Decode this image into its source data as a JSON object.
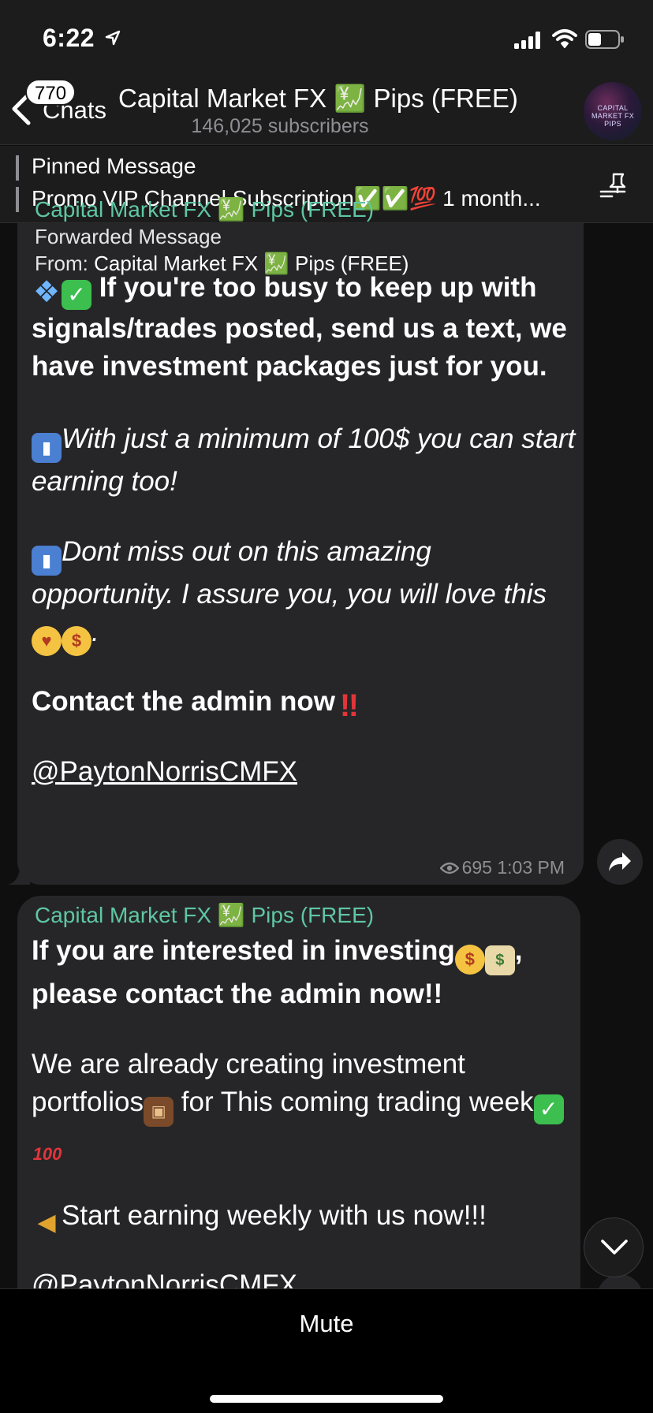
{
  "status_bar": {
    "time": "6:22"
  },
  "nav": {
    "back_label": "Chats",
    "unread_count": "770",
    "title": "Capital Market FX 💹 Pips (FREE)",
    "subtitle": "146,025 subscribers",
    "avatar_text": "CAPITAL MARKET FX PIPS"
  },
  "pinned": {
    "title": "Pinned Message",
    "text": "Promo VIP Channel Subscription✅✅💯 1 month..."
  },
  "messages": [
    {
      "sender": "Capital Market FX 💹 Pips (FREE)",
      "forwarded_label": "Forwarded Message",
      "forwarded_from_prefix": "From:",
      "forwarded_from": "Capital Market FX 💹 Pips (FREE)",
      "para1": "If you're too busy to keep up with signals/trades posted, send us a text, we have investment packages just for you.",
      "para2": "With just a minimum of 100$ you can start earning too!",
      "para3": "Dont miss out on this amazing opportunity. I assure you, you will love this",
      "para3_end": ".",
      "para4": "Contact the admin now",
      "handle": "@PaytonNorrisCMFX",
      "views": "695",
      "time": "1:03 PM"
    },
    {
      "sender": "Capital Market FX 💹 Pips (FREE)",
      "para1_a": "If you are interested in investing",
      "para1_b": ",",
      "para1_c": "please contact the admin now!!",
      "para2_a": "We are already creating investment portfolios",
      "para2_b": " for This coming trading week",
      "para3": "Start earning weekly with us now!!!",
      "handle_partial": "@PaytonNorrisCMFX"
    }
  ],
  "bottom": {
    "mute_label": "Mute"
  }
}
